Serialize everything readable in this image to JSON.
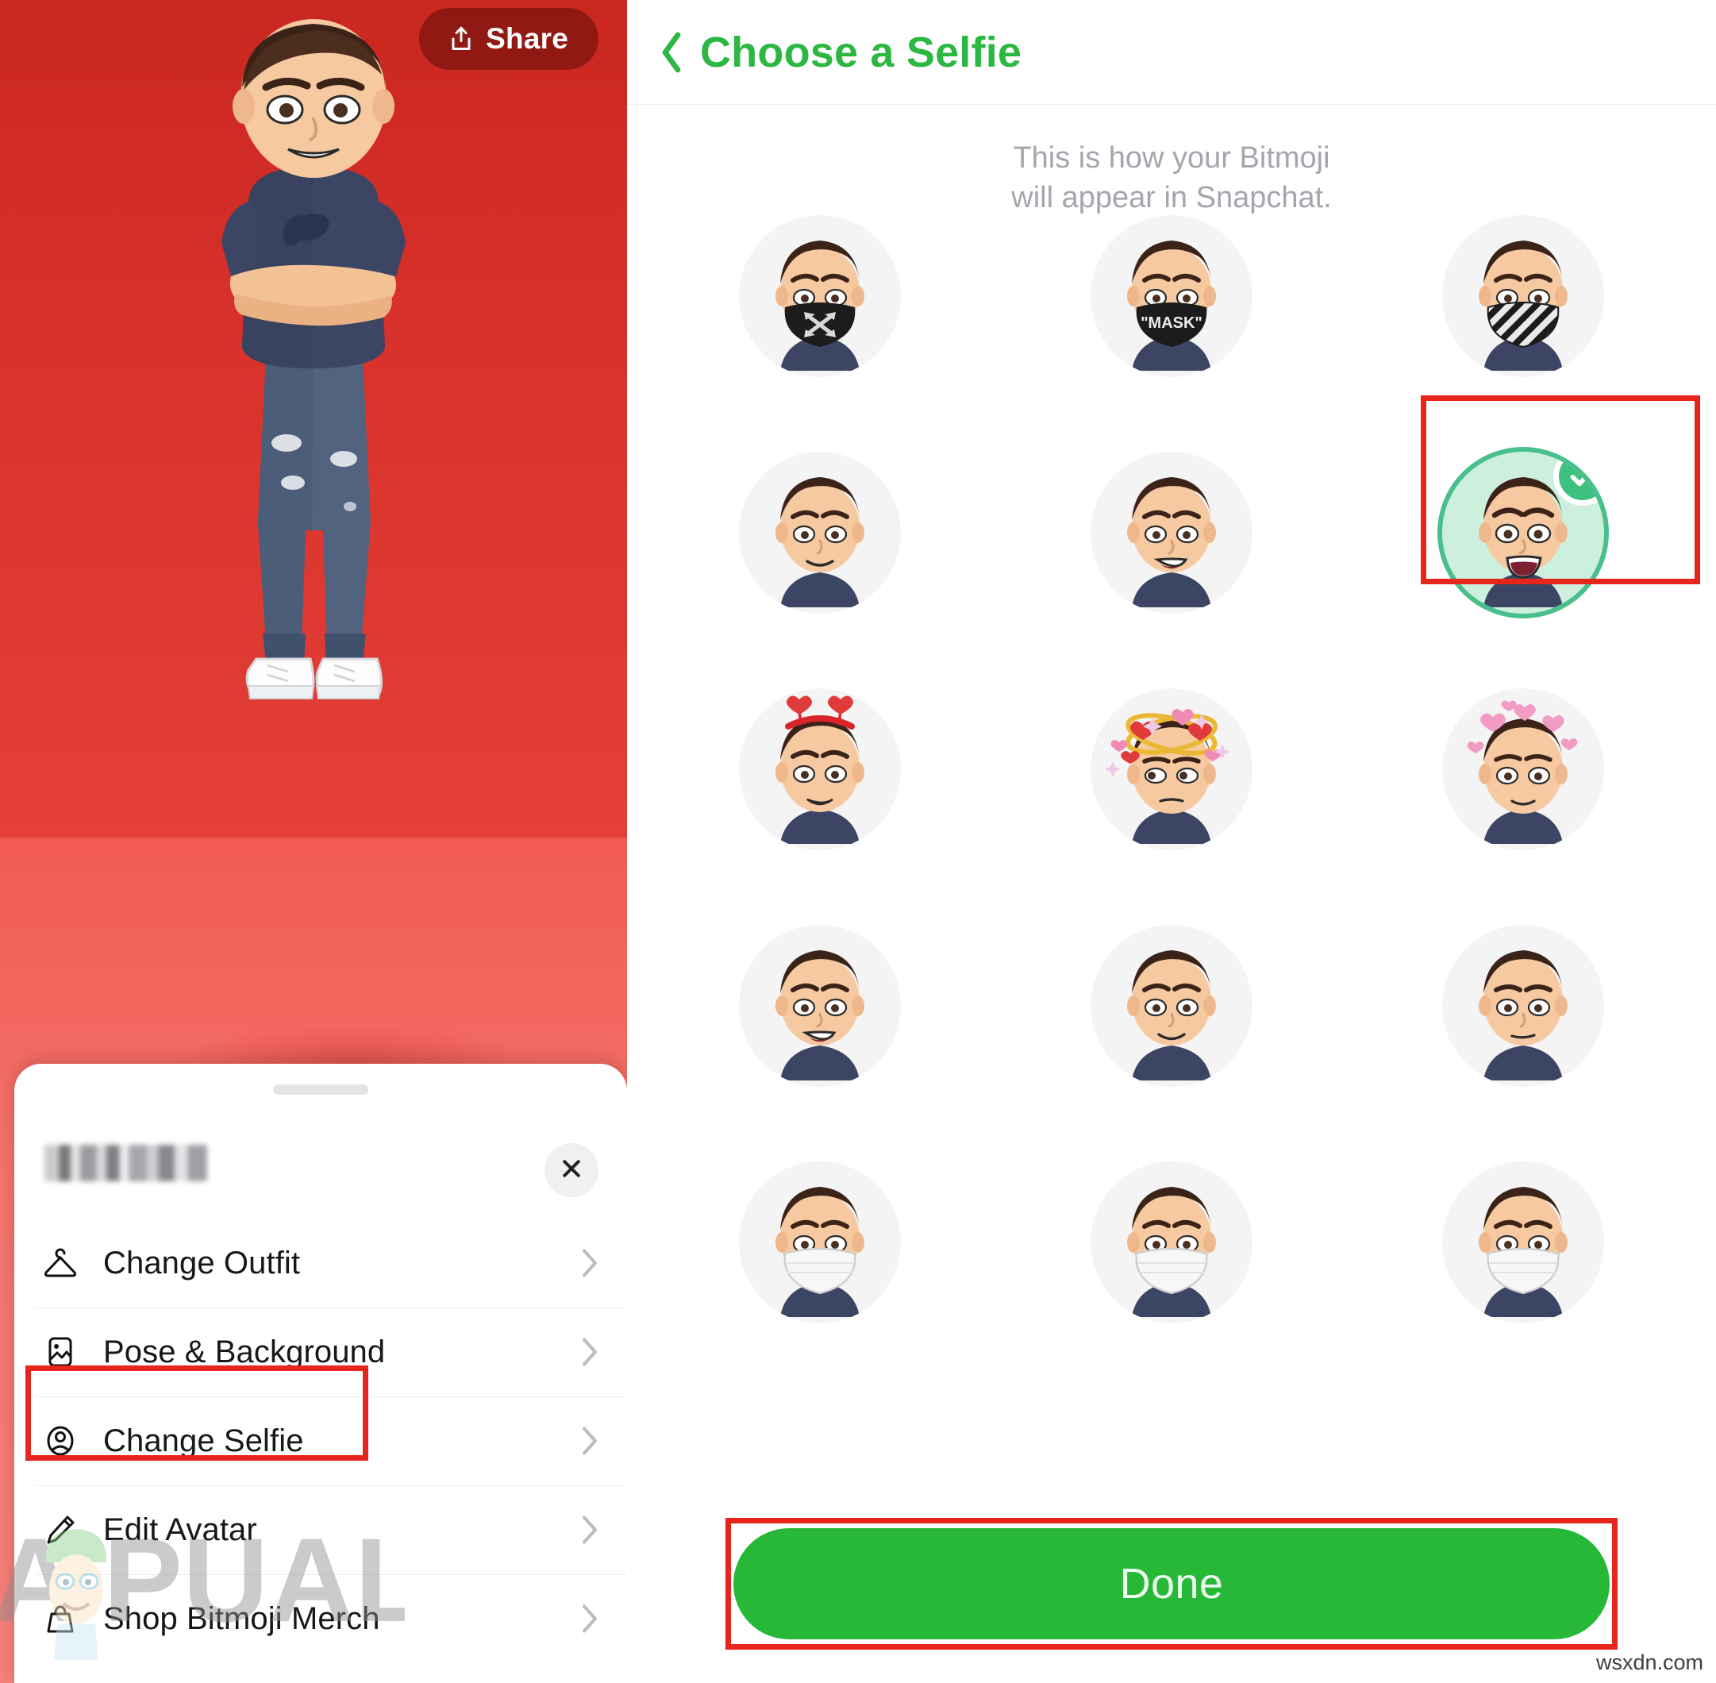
{
  "left": {
    "share_button": {
      "label": "Share",
      "icon": "share-upload-icon"
    },
    "sheet": {
      "name_redacted": "",
      "close_icon": "close-x-icon",
      "menu": [
        {
          "label": "Change Outfit",
          "icon": "clothes-hanger-icon",
          "highlighted": false
        },
        {
          "label": "Pose & Background",
          "icon": "image-photo-icon",
          "highlighted": false
        },
        {
          "label": "Change Selfie",
          "icon": "person-circle-icon",
          "highlighted": true
        },
        {
          "label": "Edit Avatar",
          "icon": "pencil-icon",
          "highlighted": false
        },
        {
          "label": "Shop Bitmoji Merch",
          "icon": "shopping-bag-icon",
          "highlighted": false
        }
      ]
    },
    "watermark": "APPUALS"
  },
  "right": {
    "nav": {
      "back_icon": "chevron-left-icon",
      "title": "Choose a Selfie"
    },
    "subtitle_line1": "This is how your Bitmoji",
    "subtitle_line2": "will appear in Snapchat.",
    "selfies": [
      {
        "id": "mask-arrows",
        "desc": "black mask with arrows",
        "mask": "arrows",
        "selected": false
      },
      {
        "id": "mask-text",
        "desc": "black mask reading MASK",
        "mask": "text",
        "mask_text": "\"MASK\"",
        "selected": false
      },
      {
        "id": "mask-stripes",
        "desc": "striped mask",
        "mask": "stripes",
        "selected": false
      },
      {
        "id": "neutral-smile",
        "desc": "neutral closed smile",
        "mouth": "smile",
        "selected": false
      },
      {
        "id": "open-smile",
        "desc": "open smile",
        "mouth": "open",
        "selected": false
      },
      {
        "id": "big-laugh",
        "desc": "big open laugh",
        "mouth": "laugh",
        "selected": true
      },
      {
        "id": "heart-headband",
        "desc": "red heart headband",
        "deco": "headband",
        "selected": false
      },
      {
        "id": "dizzy-hearts",
        "desc": "dizzy swirl with hearts",
        "deco": "dizzy",
        "selected": false
      },
      {
        "id": "pink-hearts",
        "desc": "pink floating hearts",
        "deco": "hearts",
        "selected": false
      },
      {
        "id": "plain-smile-a",
        "desc": "plain smile",
        "mouth": "open",
        "selected": false
      },
      {
        "id": "plain-smile-b",
        "desc": "plain smile",
        "mouth": "smile",
        "selected": false
      },
      {
        "id": "plain-smirk",
        "desc": "plain smirk",
        "mouth": "smirk",
        "selected": false
      },
      {
        "id": "white-mask-a",
        "desc": "white surgical mask",
        "mask": "white",
        "selected": false
      },
      {
        "id": "white-mask-b",
        "desc": "white surgical mask",
        "mask": "white",
        "selected": false
      },
      {
        "id": "white-mask-c",
        "desc": "white surgical mask",
        "mask": "white",
        "selected": false
      }
    ],
    "done_button": {
      "label": "Done"
    }
  },
  "footer_watermark": "wsxdn.com",
  "colors": {
    "brand_green": "#2cb742",
    "done_green": "#26b836",
    "selected_ring": "#49c08b",
    "selected_fill": "#cdf0de",
    "highlight_red": "#e8251c",
    "bg_red_top": "#c9271f",
    "bg_red_bottom": "#e8443c",
    "floor_red": "#f4736b",
    "bubble_grey": "#f4f4f5",
    "subtitle_grey": "#a3a7ad"
  }
}
